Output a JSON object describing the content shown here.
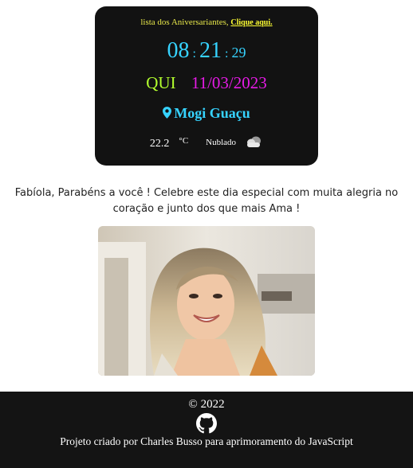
{
  "clock": {
    "birthday_prefix": "lista dos Aniversariantes,",
    "birthday_link": "Clique aqui.",
    "hours": "08",
    "minutes": "21",
    "seconds": "29",
    "separator": ":",
    "weekday": "QUI",
    "date": "11/03/2023",
    "city": "Mogi Guaçu",
    "temperature": "22.2",
    "temperature_unit": "°C",
    "condition": "Nublado"
  },
  "message": {
    "text": "Fabíola, Parabéns a você ! Celebre este dia especial com muita alegria no coração e junto dos que mais Ama !"
  },
  "footer": {
    "copyright": "© 2022",
    "credit": "Projeto criado por Charles Busso para aprimoramento do JavaScript"
  },
  "icons": {
    "location": "map-pin-icon",
    "weather": "cloud-icon",
    "github": "github-icon"
  }
}
